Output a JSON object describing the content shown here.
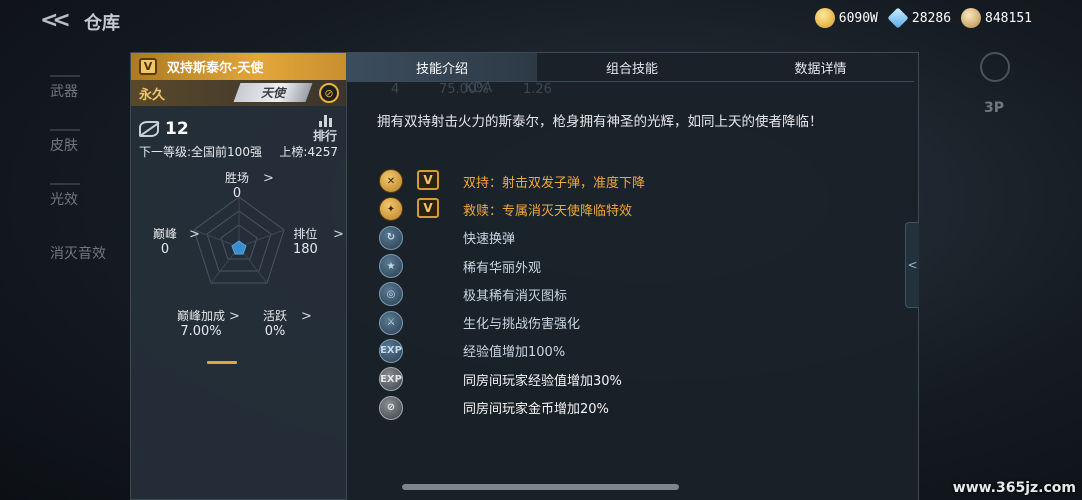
{
  "topbar": {
    "title": "仓库",
    "currencies": [
      {
        "icon": "gold-icon",
        "value": "6090W"
      },
      {
        "icon": "diamond-icon",
        "value": "28286"
      },
      {
        "icon": "coin-icon",
        "value": "848151"
      }
    ]
  },
  "catnav": {
    "items": [
      "武器",
      "皮肤",
      "光效",
      "消灭音效"
    ]
  },
  "side": {
    "view_label": "3P"
  },
  "card": {
    "badge": "V",
    "title": "双持斯泰尔-天使",
    "duration": "永久",
    "tag": "天使",
    "kills": "12",
    "rank_label": "排行",
    "next_level": "下一等级:全国前100强",
    "on_list": "上榜:4257",
    "stats": {
      "wins": {
        "label": "胜场",
        "value": "0"
      },
      "rank": {
        "label": "排位",
        "value": "180"
      },
      "peak": {
        "label": "巅峰",
        "value": "0"
      },
      "peak_bonus": {
        "label": "巅峰加成",
        "value": "7.00%"
      },
      "active": {
        "label": "活跃",
        "value": "0%"
      }
    },
    "chevron": ">"
  },
  "tabs": [
    {
      "label": "技能介绍",
      "active": true
    },
    {
      "label": "组合技能",
      "active": false
    },
    {
      "label": "数据详情",
      "active": false
    }
  ],
  "ghost": {
    "kda_label": "KDA",
    "row": [
      "4",
      "75.00%",
      "1.26"
    ]
  },
  "description": "拥有双持射击火力的斯泰尔，枪身拥有神圣的光辉，如同上天的使者降临！",
  "features": [
    {
      "icon": "dual-wield-icon",
      "style": "gold",
      "v": "V",
      "text": "双持：射击双发子弹，准度下降"
    },
    {
      "icon": "redemption-icon",
      "style": "gold",
      "v": "V",
      "text": "救赎：专属消灭天使降临特效"
    },
    {
      "icon": "fast-reload-icon",
      "style": "blue",
      "text": "快速换弹"
    },
    {
      "icon": "rare-skin-icon",
      "style": "blue",
      "text": "稀有华丽外观"
    },
    {
      "icon": "kill-icon-badge",
      "style": "blue",
      "text": "极其稀有消灭图标"
    },
    {
      "icon": "biochem-damage-icon",
      "style": "blue",
      "text": "生化与挑战伤害强化"
    },
    {
      "icon": "exp-boost-icon",
      "style": "blue",
      "text": "经验值增加100%"
    },
    {
      "icon": "room-exp-icon",
      "style": "grey",
      "text": "同房间玩家经验值增加30%"
    },
    {
      "icon": "room-gold-icon",
      "style": "grey",
      "text": "同房间玩家金币增加20%"
    }
  ],
  "watermark": "www.365jz.com"
}
